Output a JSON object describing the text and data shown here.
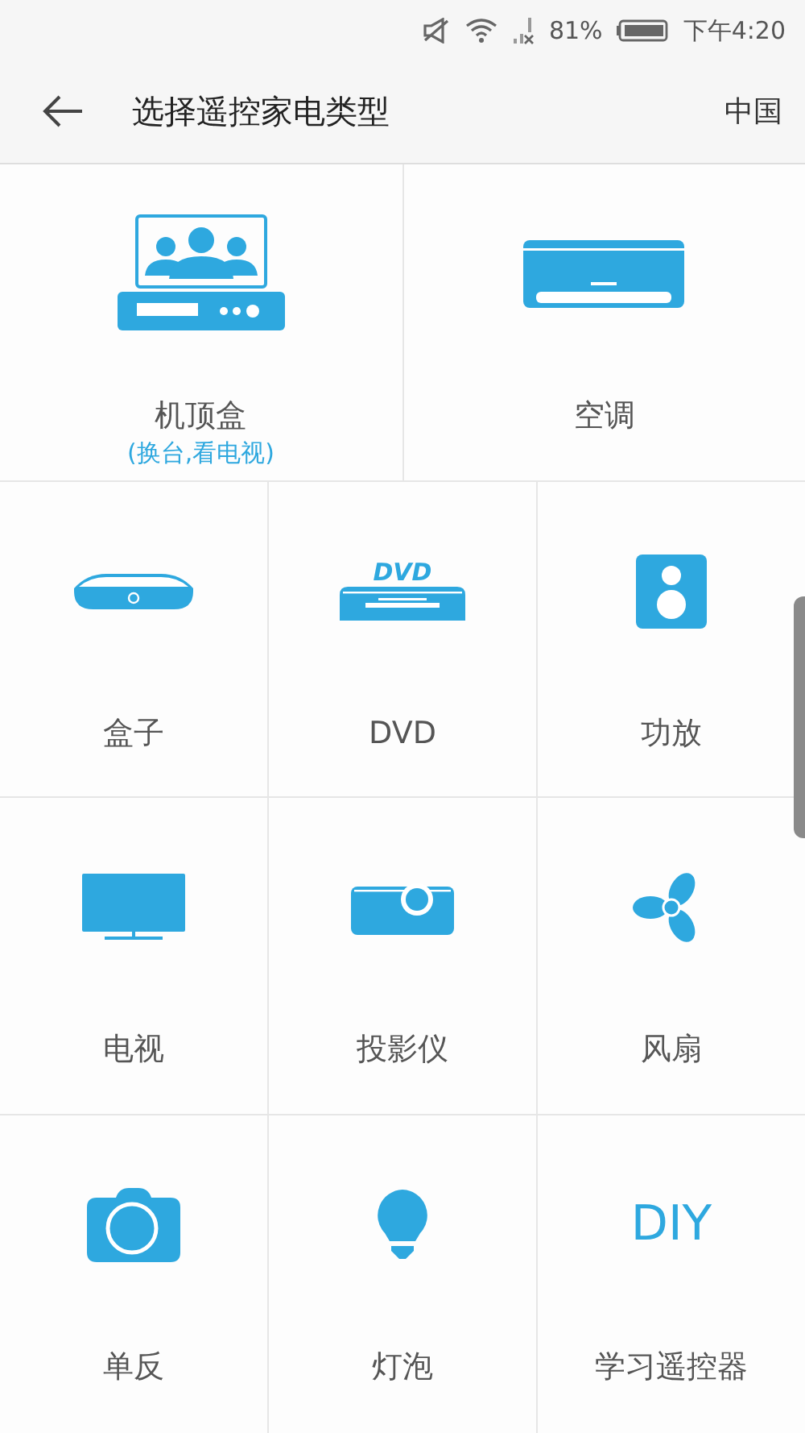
{
  "status_bar": {
    "battery_percent": "81%",
    "time": "下午4:20"
  },
  "header": {
    "title": "选择遥控家电类型",
    "region": "中国"
  },
  "rows": [
    [
      {
        "kind": "settop",
        "label": "机顶盒",
        "subtitle": "(换台,看电视)"
      },
      {
        "kind": "aircon",
        "label": "空调"
      }
    ],
    [
      {
        "kind": "box",
        "label": "盒子"
      },
      {
        "kind": "dvd",
        "label": "DVD",
        "icon_text": "DVD"
      },
      {
        "kind": "speaker",
        "label": "功放"
      }
    ],
    [
      {
        "kind": "tv",
        "label": "电视"
      },
      {
        "kind": "projector",
        "label": "投影仪"
      },
      {
        "kind": "fan",
        "label": "风扇"
      }
    ],
    [
      {
        "kind": "camera",
        "label": "单反"
      },
      {
        "kind": "bulb",
        "label": "灯泡"
      },
      {
        "kind": "diy",
        "label": "学习遥控器",
        "icon_text": "DIY"
      }
    ]
  ]
}
